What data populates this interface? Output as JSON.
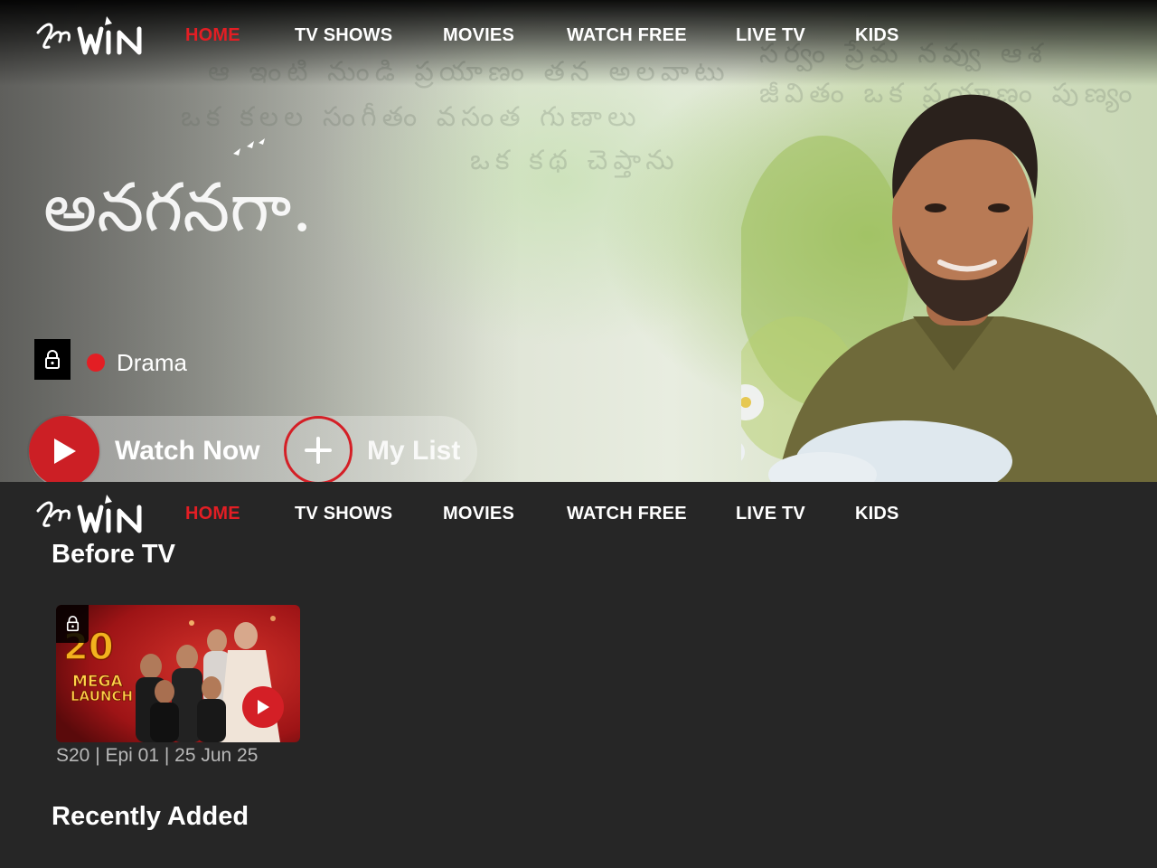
{
  "nav": {
    "logo_text": "ETV WIN",
    "items": [
      {
        "label": "HOME",
        "active": true
      },
      {
        "label": "TV SHOWS",
        "active": false
      },
      {
        "label": "MOVIES",
        "active": false
      },
      {
        "label": "WATCH FREE",
        "active": false
      },
      {
        "label": "LIVE TV",
        "active": false
      },
      {
        "label": "KIDS",
        "active": false
      }
    ]
  },
  "hero": {
    "title_art_text": "అనగనగా...",
    "genre": "Drama",
    "watch_label": "Watch Now",
    "mylist_label": "My List",
    "icons": {
      "lock": "lock-icon",
      "play": "play-icon",
      "add": "plus-icon"
    }
  },
  "sections": {
    "before_tv": {
      "title": "Before TV",
      "card": {
        "art_text": [
          "MEGA",
          "LAUNCH"
        ],
        "meta": "S20 | Epi 01 | 25 Jun 25"
      }
    },
    "recently_added": {
      "title": "Recently Added"
    }
  },
  "colors": {
    "accent": "#e31e24",
    "background": "#262626"
  }
}
